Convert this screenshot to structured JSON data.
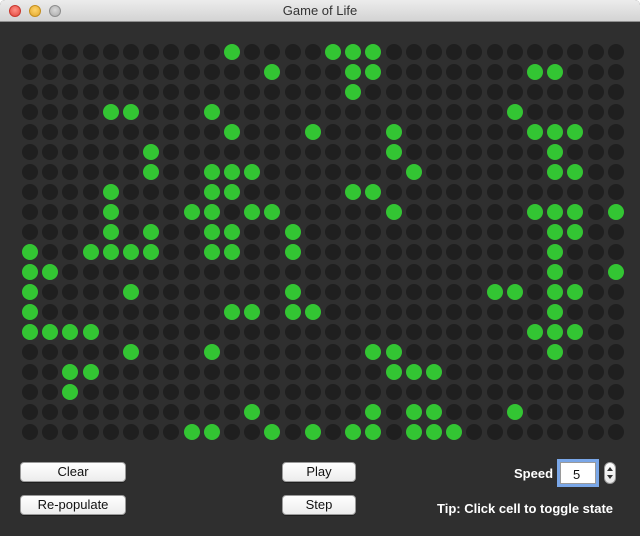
{
  "window": {
    "title": "Game of Life"
  },
  "grid": {
    "rows": 20,
    "cols": 30,
    "alive": [
      "..........#....###............",
      "............#...##.......##...",
      "................#.............",
      "....##...#..............#.....",
      "..........#...#...#......###..",
      "......#...........#.......#...",
      "......#..###.......#......##..",
      "....#....##.....##............",
      "....#...##.##.....#......###.##",
      "....#.#..##..#............##...",
      "#..####..##..#............#...",
      "##........................#..##",
      "#....#.......#.........##.##..",
      "#.........##.##...........#...",
      "####.....................###..",
      ".....#...#.......##.......#...",
      "..##..............###........",
      "..#.........................",
      "...........#.....#.##...#......",
      "........##..#.#.##.###........"
    ]
  },
  "controls": {
    "clear_label": "Clear",
    "repopulate_label": "Re-populate",
    "play_label": "Play",
    "step_label": "Step",
    "speed_label": "Speed",
    "speed_value": "5",
    "tip": "Tip: Click cell to toggle state"
  },
  "colors": {
    "alive": "#33c533",
    "dead": "#1f1f1f",
    "background": "#2f2f2f"
  }
}
